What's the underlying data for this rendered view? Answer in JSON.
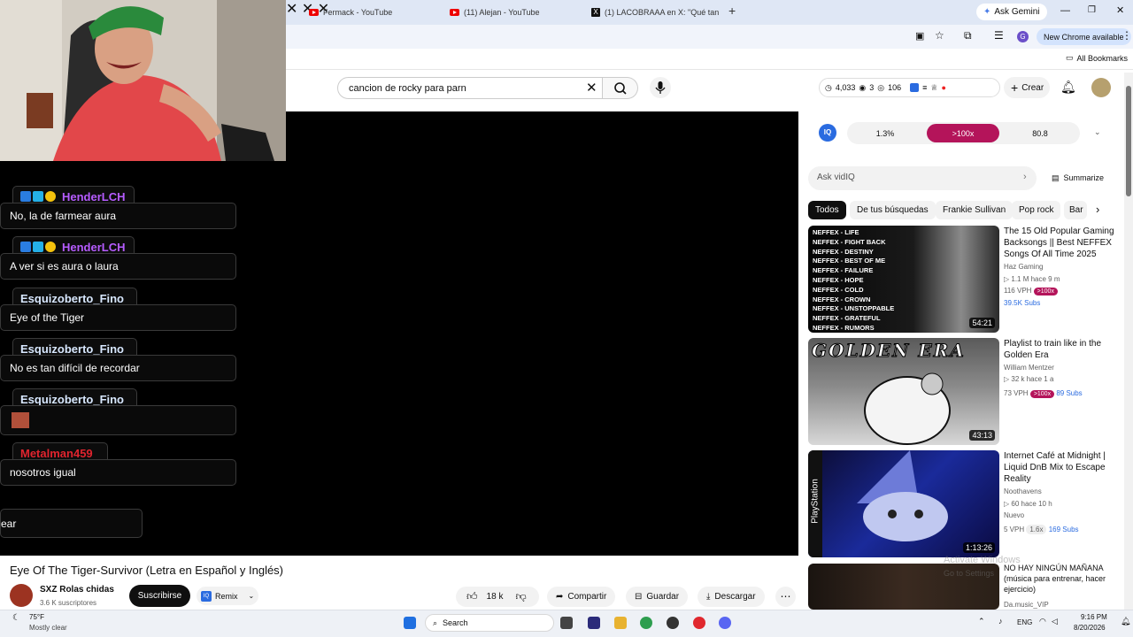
{
  "tabs": [
    {
      "label": "Fermack - YouTube",
      "icon": "youtube-icon"
    },
    {
      "label": "(11) Alejan - YouTube",
      "icon": "youtube-icon"
    },
    {
      "label": "(1) LACOBRAAA en X: \"Qué tan",
      "icon": "x-icon"
    }
  ],
  "ask_gemini": "Ask Gemini",
  "new_chrome": "New Chrome available",
  "all_bookmarks": "All Bookmarks",
  "search": {
    "value": "cancion de rocky para parn"
  },
  "header_stats": {
    "a": "4,033",
    "b": "3",
    "c": "106"
  },
  "crear": "Crear",
  "vidiq": {
    "metric1": "1.3%",
    "metric2": ">100x",
    "metric3": "80.8",
    "ask_placeholder": "Ask vidIQ",
    "summarize": "Summarize",
    "logo": "IQ"
  },
  "chips": [
    "Todos",
    "De tus búsquedas",
    "Frankie Sullivan",
    "Pop rock",
    "Bar"
  ],
  "chat": [
    {
      "user": "HenderLCH",
      "color": "#b65cff",
      "message": "No, la de farmear aura",
      "badges": true
    },
    {
      "user": "HenderLCH",
      "color": "#b65cff",
      "message": "A ver si es aura o laura",
      "badges": true
    },
    {
      "user": "Esquizoberto_Fino",
      "color": "#d8e8ff",
      "message": "Eye of the Tiger",
      "badges": false
    },
    {
      "user": "Esquizoberto_Fino",
      "color": "#d8e8ff",
      "message": "No es tan difícil de recordar",
      "badges": false
    },
    {
      "user": "Esquizoberto_Fino",
      "color": "#d8e8ff",
      "message": "",
      "badges": false
    },
    {
      "user": "Metalman459",
      "color": "#e0242e",
      "message": "nosotros igual",
      "badges": false
    }
  ],
  "chat_partial": "ear",
  "video_title": "Eye Of The Tiger-Survivor (Letra en Español y Inglés)",
  "channel": {
    "name": "SXZ Rolas chidas",
    "subs": "3.6 K suscriptores"
  },
  "subscribe": "Suscribirse",
  "remix": "Remix",
  "actions": {
    "likes": "18 k",
    "share": "Compartir",
    "save": "Guardar",
    "download": "Descargar"
  },
  "recommendations": [
    {
      "title": "The 15 Old Popular Gaming Backsongs || Best NEFFEX Songs Of All Time 2025",
      "channel": "Haz Gaming",
      "meta": "1.1 M  hace 9 m",
      "vph": "116 VPH",
      "tag": ">100x",
      "subs": "39.5K Subs",
      "duration": "54:21",
      "thumb_lines": [
        "NEFFEX - LIFE",
        "NEFFEX - FIGHT BACK",
        "NEFFEX - DESTINY",
        "NEFFEX - BEST OF ME",
        "NEFFEX - FAILURE",
        "NEFFEX - HOPE",
        "NEFFEX - COLD",
        "NEFFEX - CROWN",
        "NEFFEX - UNSTOPPABLE",
        "NEFFEX - GRATEFUL",
        "NEFFEX - RUMORS"
      ]
    },
    {
      "title": "Playlist to train like in the Golden Era",
      "channel": "William Mentzer",
      "meta": "32 k  hace 1 a",
      "vph": "73 VPH",
      "tag": ">100x",
      "subs": "89 Subs",
      "duration": "43:13",
      "thumb_text": "GOLDEN ERA"
    },
    {
      "title": "Internet Café at Midnight | Liquid DnB Mix to Escape Reality",
      "channel": "Noothavens",
      "meta": "60  hace 10 h",
      "badge": "Nuevo",
      "vph": "5 VPH",
      "tag": "1.6x",
      "subs": "169 Subs",
      "duration": "1:13:26",
      "thumb_text": "PlayStation"
    },
    {
      "title": "NO HAY NINGÚN MAÑANA (música para entrenar, hacer ejercicio)",
      "channel": "Da.music_VIP"
    }
  ],
  "activate_windows": [
    "Activate Windows",
    "Go to Settings"
  ],
  "weather": {
    "temp": "75°F",
    "desc": "Mostly clear"
  },
  "taskbar_search": "Search",
  "tray": {
    "lang": "ENG",
    "time": "9:16 PM",
    "date": "8/20/2026"
  }
}
